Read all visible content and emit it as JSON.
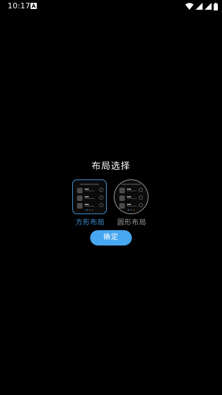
{
  "status_bar": {
    "time": "10:17",
    "icons": [
      "notification-a-icon",
      "wifi-icon",
      "signal-icon",
      "signal-2-icon",
      "battery-icon"
    ]
  },
  "dialog": {
    "title": "布局选择",
    "options": [
      {
        "id": "square",
        "label": "方形布局",
        "selected": true
      },
      {
        "id": "round",
        "label": "圆形布局",
        "selected": false
      }
    ],
    "confirm_label": "确定"
  },
  "colors": {
    "background": "#000000",
    "accent": "#3f8fd2",
    "button": "#47a7f0",
    "muted": "#9a9a9a"
  }
}
